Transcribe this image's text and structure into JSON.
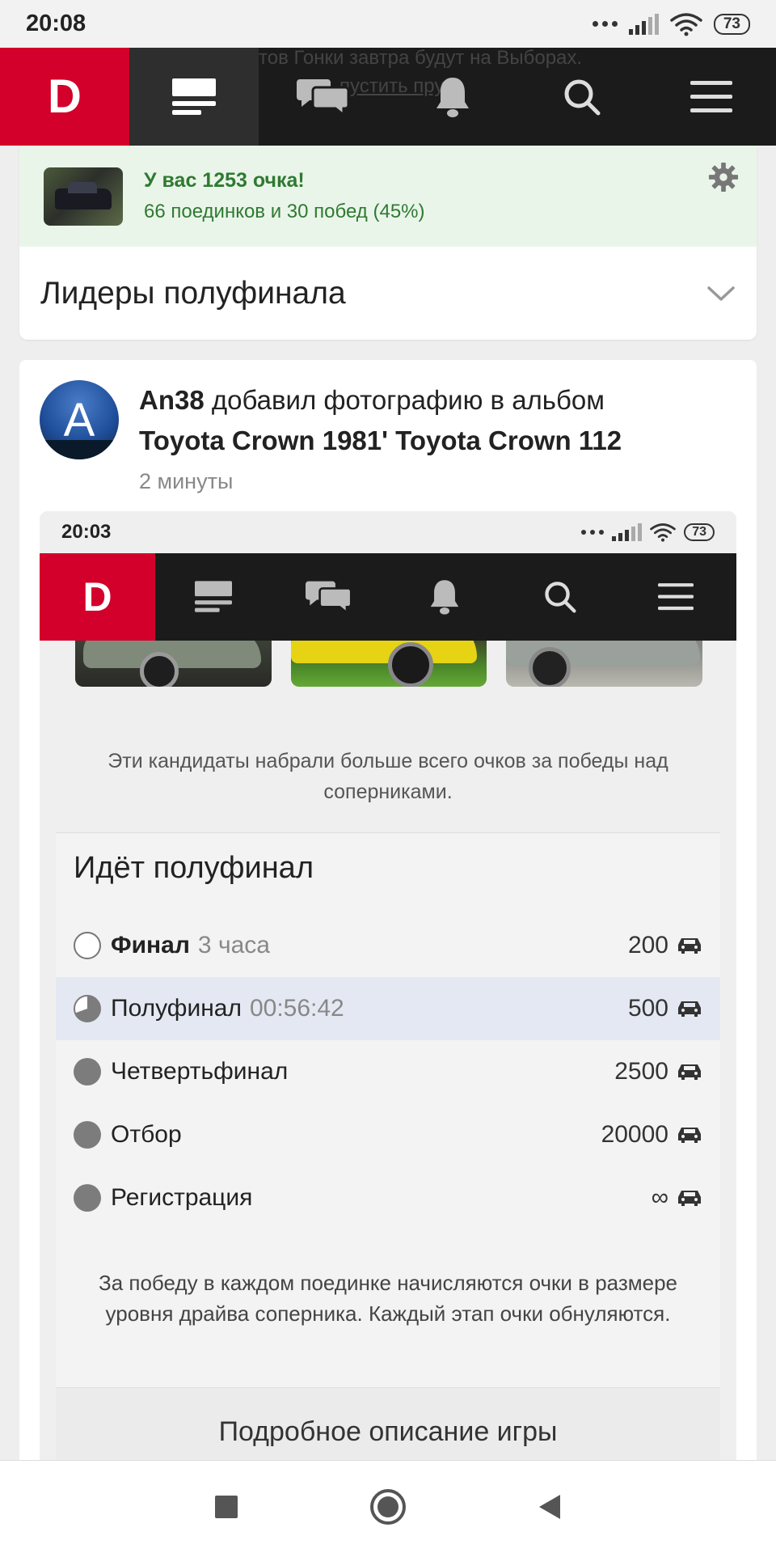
{
  "status_bar": {
    "time": "20:08",
    "battery": "73"
  },
  "top_nav": {
    "logo": "D",
    "background_text_1": "тов Гонки завтра будут на Выборах.",
    "background_text_2": "пустить пру",
    "items": [
      "feed-icon",
      "messages-icon",
      "bell-icon",
      "search-icon",
      "menu-icon"
    ]
  },
  "score": {
    "title": "У вас 1253 очка!",
    "subtitle": "66 поединков и 30 побед (45%)"
  },
  "leaders": {
    "title": "Лидеры полуфинала"
  },
  "post": {
    "avatar_letter": "A",
    "author": "An38",
    "action": "добавил фотографию в альбом",
    "album": "Toyota Crown 1981' Toyota Crown 112",
    "time": "2 минуты"
  },
  "embedded_screenshot": {
    "status_time": "20:03",
    "battery": "73",
    "logo": "D",
    "description": "Эти кандидаты набрали больше всего очков за победы над соперниками.",
    "panel_title": "Идёт полуфинал",
    "stages": [
      {
        "name": "Финал",
        "meta": "3 часа",
        "points": "200",
        "state": "empty",
        "bold": true
      },
      {
        "name": "Полуфинал",
        "meta": "00:56:42",
        "points": "500",
        "state": "partial",
        "bold": false,
        "current": true
      },
      {
        "name": "Четвертьфинал",
        "meta": "",
        "points": "2500",
        "state": "filled",
        "bold": false
      },
      {
        "name": "Отбор",
        "meta": "",
        "points": "20000",
        "state": "filled",
        "bold": false
      },
      {
        "name": "Регистрация",
        "meta": "",
        "points": "∞",
        "state": "filled",
        "bold": false
      }
    ],
    "note": "За победу в каждом поединке начисляются очки в размере уровня драйва соперника. Каждый этап очки обнуляются.",
    "details_button": "Подробное описание игры"
  },
  "colors": {
    "brand_red": "#d2002a",
    "nav_dark": "#1b1b1b",
    "score_green": "#2f7a31",
    "score_bg": "#eaf5ea",
    "current_stage_bg": "#e3e8f2"
  }
}
